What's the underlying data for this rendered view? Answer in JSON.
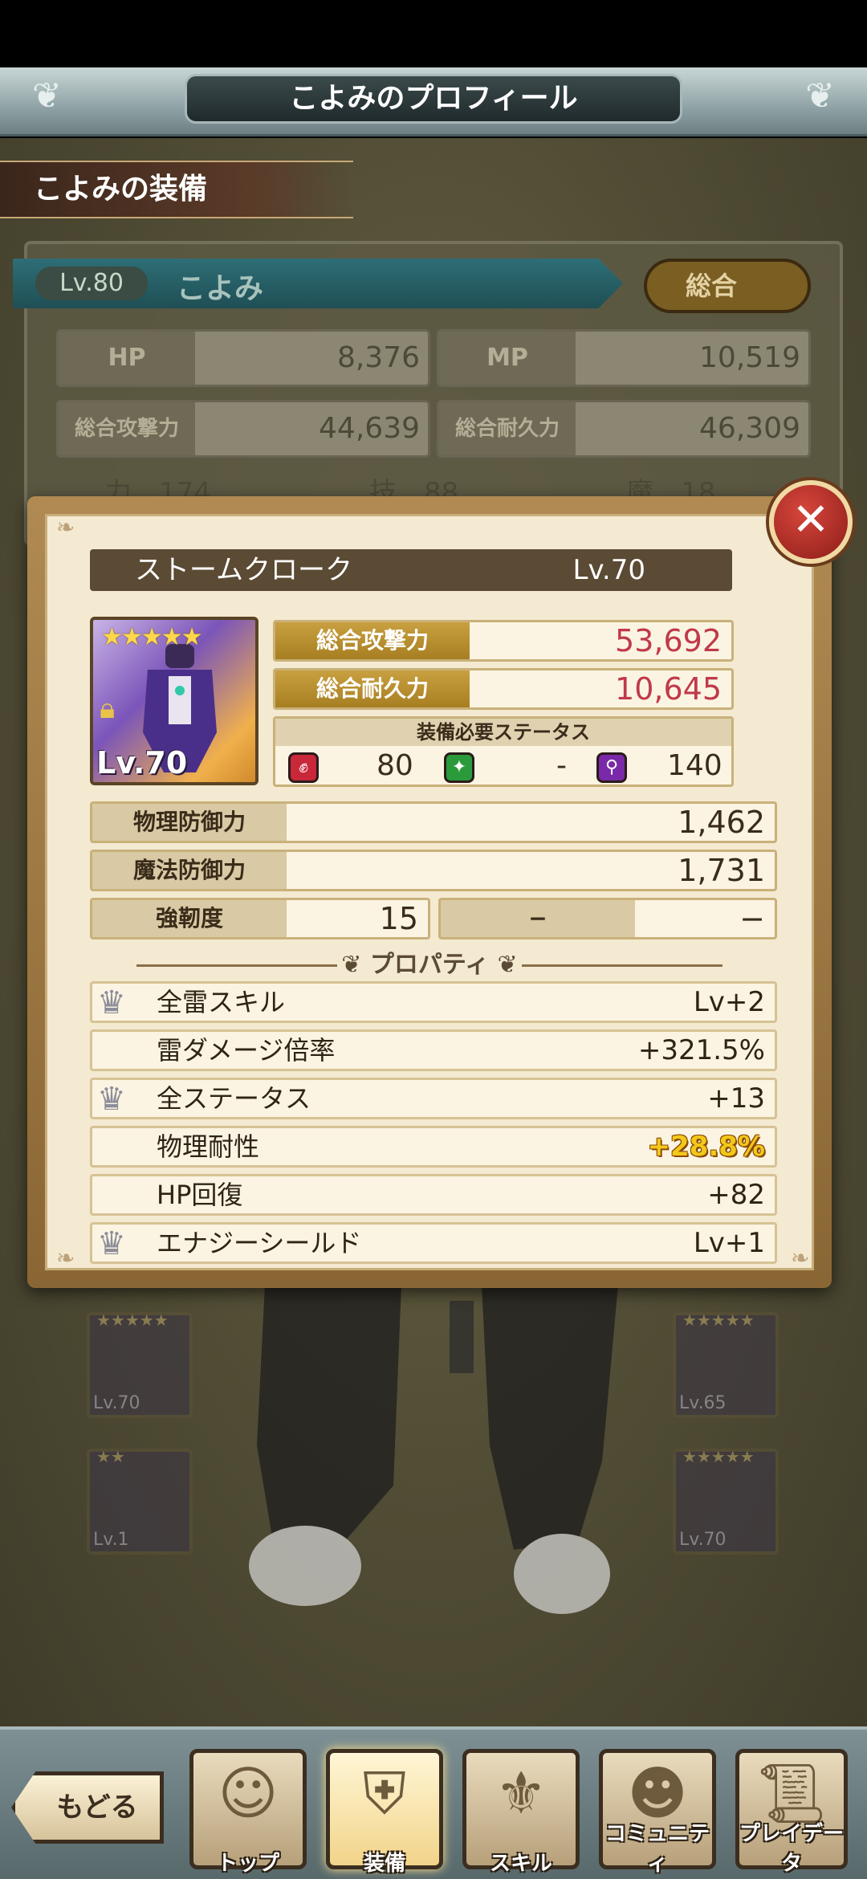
{
  "header": {
    "title": "こよみのプロフィール"
  },
  "section": {
    "title": "こよみの装備"
  },
  "profile": {
    "level": "Lv.80",
    "name": "こよみ",
    "toggle_label": "総合",
    "stats": [
      {
        "label": "HP",
        "value": "8,376"
      },
      {
        "label": "MP",
        "value": "10,519"
      },
      {
        "label": "総合攻撃力",
        "value": "44,639"
      },
      {
        "label": "総合耐久力",
        "value": "46,309"
      }
    ],
    "attributes": [
      {
        "label": "力",
        "value": "174"
      },
      {
        "label": "技",
        "value": "88"
      },
      {
        "label": "魔",
        "value": "18"
      }
    ]
  },
  "equipment_slots": [
    {
      "level": "Lv.70"
    },
    {
      "level": "Lv.65"
    },
    {
      "level": "Lv.1"
    },
    {
      "level": "Lv.70"
    }
  ],
  "item": {
    "name": "ストームクローク",
    "level": "Lv.70",
    "icon_level": "Lv.70",
    "stars": "★★★★★",
    "attack_label": "総合攻撃力",
    "attack": "53,692",
    "defense_label": "総合耐久力",
    "defense": "10,645",
    "required_title": "装備必要ステータス",
    "required": [
      {
        "icon": "fist-icon",
        "value": "80"
      },
      {
        "icon": "sparkle-icon",
        "value": "-"
      },
      {
        "icon": "magic-wand-icon",
        "value": "140"
      }
    ],
    "phys_def_label": "物理防御力",
    "phys_def": "1,462",
    "mag_def_label": "魔法防御力",
    "mag_def": "1,731",
    "toughness_label": "強靭度",
    "toughness": "15",
    "empty_label": "−",
    "empty_value": "−",
    "properties_title": "プロパティ",
    "properties": [
      {
        "name": "全雷スキル",
        "value": "Lv+2",
        "crown": true,
        "highlight": false
      },
      {
        "name": "雷ダメージ倍率",
        "value": "+321.5%",
        "crown": false,
        "highlight": false
      },
      {
        "name": "全ステータス",
        "value": "+13",
        "crown": true,
        "highlight": false
      },
      {
        "name": "物理耐性",
        "value": "+28.8%",
        "crown": false,
        "highlight": true
      },
      {
        "name": "HP回復",
        "value": "+82",
        "crown": false,
        "highlight": false
      },
      {
        "name": "エナジーシールド",
        "value": "Lv+1",
        "crown": true,
        "highlight": false
      }
    ]
  },
  "nav": {
    "back": "もどる",
    "items": [
      {
        "label": "トップ",
        "icon": "face-icon"
      },
      {
        "label": "装備",
        "icon": "armor-icon"
      },
      {
        "label": "スキル",
        "icon": "skill-icon"
      },
      {
        "label": "コミュニティ",
        "icon": "community-icon"
      },
      {
        "label": "プレイデータ",
        "icon": "scroll-icon"
      }
    ]
  },
  "colors": {
    "accent_red": "#c0394a",
    "gold": "#a77f22",
    "highlight_yellow": "#f2c81a"
  }
}
